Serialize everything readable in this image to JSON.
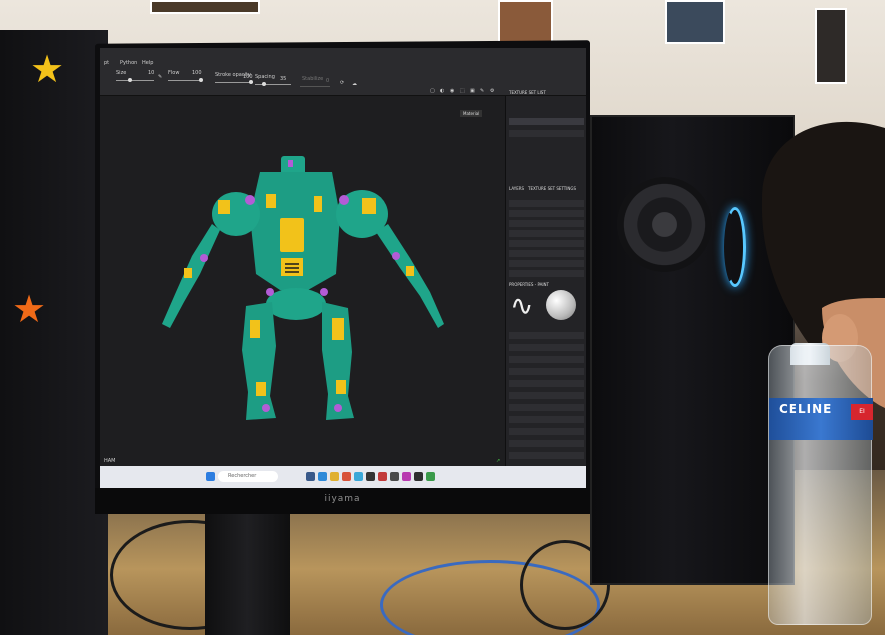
{
  "toolbar": {
    "menu": [
      "pt",
      "Python",
      "Help"
    ],
    "size_label": "Size",
    "size_value": "10",
    "flow_label": "Flow",
    "flow_value": "100",
    "stroke_opacity_label": "Stroke opacity",
    "stroke_opacity_value": "100",
    "spacing_label": "Spacing",
    "spacing_value": "35",
    "stabilize_label": "Stabilize",
    "stabilize_value": "0"
  },
  "right_panel": {
    "header": "TEXTURE SET LIST",
    "material_tab": "Material",
    "layers_tab": "LAYERS",
    "texture_set_settings": "TEXTURE SET SETTINGS",
    "properties_tab": "PROPERTIES - PAINT"
  },
  "viewport": {
    "model": "green-yellow-robot"
  },
  "taskbar": {
    "search_placeholder": "Rechercher",
    "status_label": "HAM"
  },
  "monitor": {
    "brand": "iiyama"
  },
  "bottle": {
    "brand": "CELINE"
  },
  "colors": {
    "robot_body": "#1fa58a",
    "robot_accent": "#f2c21a",
    "robot_joint": "#b35cd6",
    "case_led": "#58c8ff"
  }
}
